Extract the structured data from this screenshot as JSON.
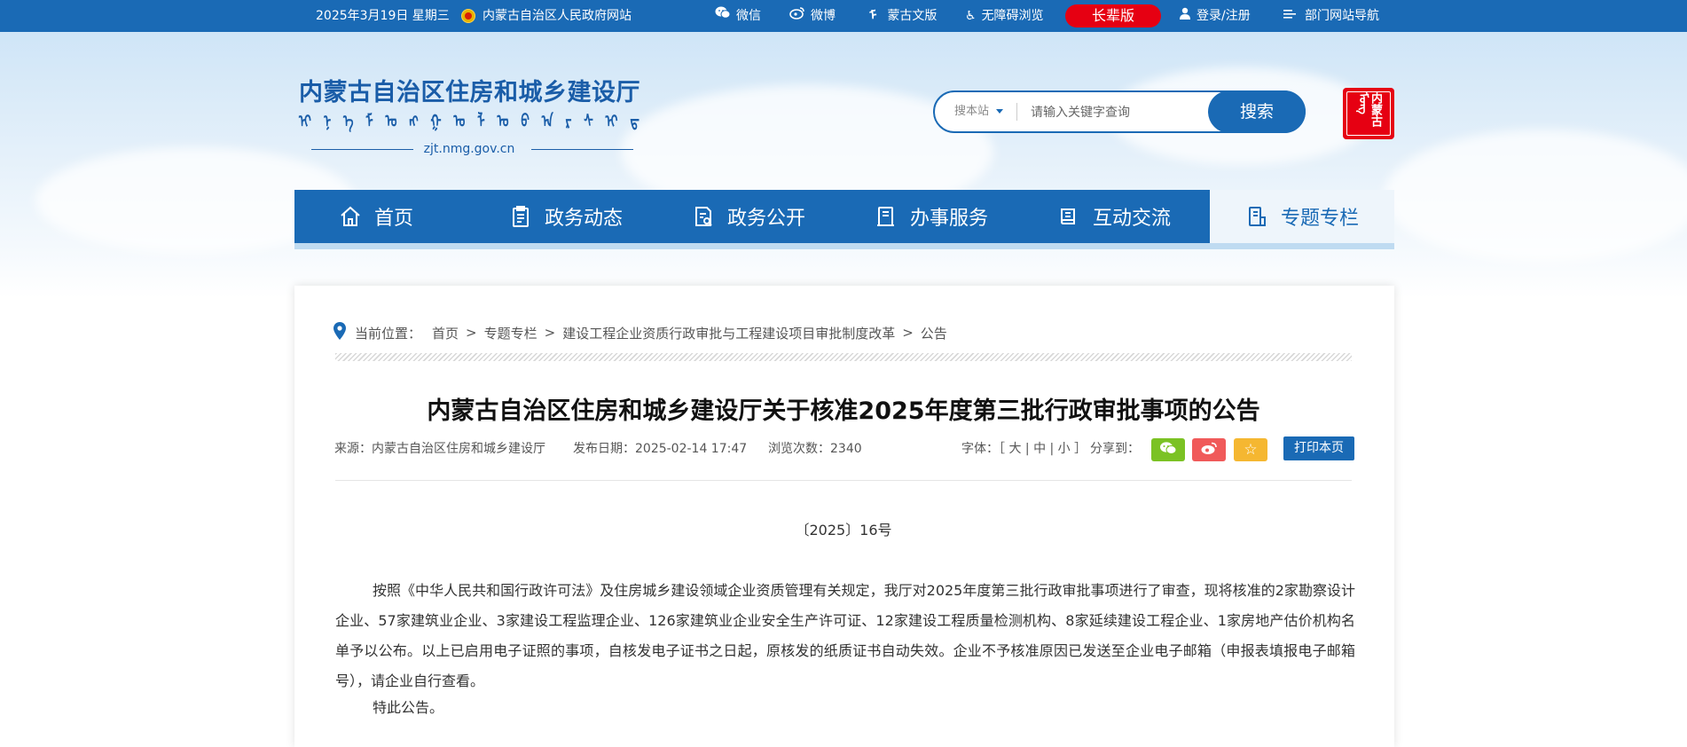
{
  "topbar": {
    "date": "2025年3月19日 星期三",
    "gov_site": "内蒙古自治区人民政府网站",
    "wechat": "微信",
    "weibo": "微博",
    "mongolian": "蒙古文版",
    "accessible": "无障碍浏览",
    "elder": "长辈版",
    "login": "登录/注册",
    "dept_nav": "部门网站导航"
  },
  "header": {
    "site_title": "内蒙古自治区住房和城乡建设厅",
    "domain": "zjt.nmg.gov.cn",
    "seal_text": "内蒙古ᠮᠣᠩᠭᠣᠯ"
  },
  "search": {
    "scope": "搜本站",
    "placeholder": "请输入关键字查询",
    "button": "搜索"
  },
  "nav": {
    "items": [
      {
        "label": "首页",
        "icon": "home-icon"
      },
      {
        "label": "政务动态",
        "icon": "clipboard-icon"
      },
      {
        "label": "政务公开",
        "icon": "document-icon"
      },
      {
        "label": "办事服务",
        "icon": "service-icon"
      },
      {
        "label": "互动交流",
        "icon": "book-icon"
      },
      {
        "label": "专题专栏",
        "icon": "topic-icon"
      }
    ],
    "active_index": 5
  },
  "breadcrumb": {
    "label": "当前位置：",
    "items": [
      "首页",
      "专题专栏",
      "建设工程企业资质行政审批与工程建设项目审批制度改革",
      "公告"
    ]
  },
  "article": {
    "title": "内蒙古自治区住房和城乡建设厅关于核准2025年度第三批行政审批事项的公告",
    "source": "来源：内蒙古自治区住房和城乡建设厅",
    "date": "发布日期：2025-02-14 17:47",
    "views": "浏览次数：2340",
    "font_label": "字体：［ 大 | 中 | 小 ］",
    "share_label": "分享到：",
    "print": "打印本页",
    "doc_number": "〔2025〕16号",
    "paragraph": "按照《中华人民共和国行政许可法》及住房城乡建设领域企业资质管理有关规定，我厅对2025年度第三批行政审批事项进行了审查，现将核准的2家勘察设计企业、57家建筑业企业、3家建设工程监理企业、126家建筑业企业安全生产许可证、12家建设工程质量检测机构、8家延续建设工程企业、1家房地产估价机构名单予以公布。以上已启用电子证照的事项，自核发电子证书之日起，原核发的纸质证书自动失效。企业不予核准原因已发送至企业电子邮箱（申报表填报电子邮箱号），请企业自行查看。",
    "closing": "特此公告。"
  },
  "colors": {
    "primary": "#1a6ab5",
    "elder": "#e60012",
    "wechat_share": "#7bc224",
    "weibo_share": "#f05a5a",
    "favorite_share": "#f5b731"
  }
}
